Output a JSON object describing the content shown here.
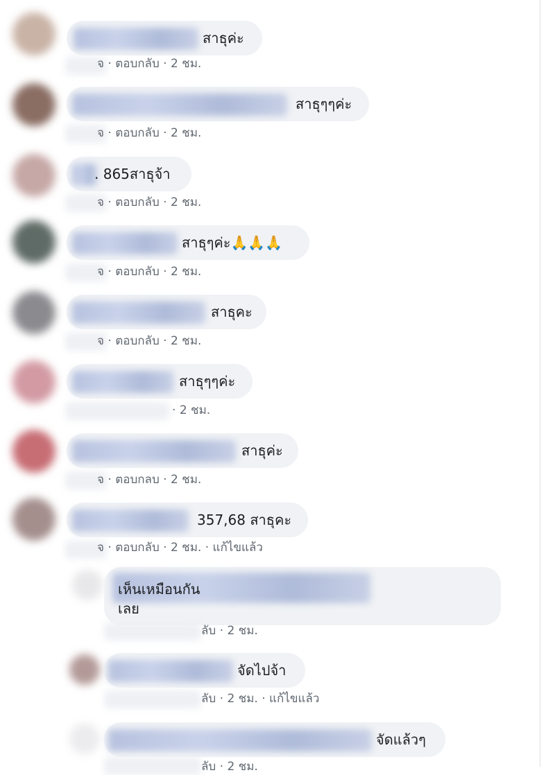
{
  "comments": [
    {
      "text": "สาธุค่ะ",
      "meta": {
        "like": "จ",
        "reply": "ตอบกลับ",
        "time": "2 ชม."
      }
    },
    {
      "text": "สาธุๆๆค่ะ",
      "meta": {
        "like": "จ",
        "reply": "ตอบกลับ",
        "time": "2 ชม."
      }
    },
    {
      "text": ". 865สาธุจ้า",
      "meta": {
        "like": "จ",
        "reply": "ตอบกลับ",
        "time": "2 ชม."
      }
    },
    {
      "text": "สาธุๆค่ะ🙏🙏🙏",
      "meta": {
        "like": "จ",
        "reply": "ตอบกลับ",
        "time": "2 ชม."
      }
    },
    {
      "text": "สาธุคะ",
      "meta": {
        "like": "จ",
        "reply": "ตอบกลับ",
        "time": "2 ชม."
      }
    },
    {
      "text": "สาธุๆๆค่ะ",
      "meta": {
        "like": "",
        "reply": "",
        "time": "2 ชม."
      }
    },
    {
      "text": "สาธุค่ะ",
      "meta": {
        "like": "จ",
        "reply": "ตอบกลบ",
        "time": "2 ชม."
      }
    },
    {
      "text": "357,68 สาธุคะ",
      "meta": {
        "like": "จ",
        "reply": "ตอบกลับ",
        "time": "2 ชม.",
        "edited": "แก้ไขแล้ว"
      }
    }
  ],
  "replies": [
    {
      "text": "เห็นเหมือนกัน\nเลย",
      "meta": {
        "reply": "ลับ",
        "time": "2 ชม."
      }
    },
    {
      "text": "จัดไปจ้า",
      "meta": {
        "reply": "ลับ",
        "time": "2 ชม.",
        "edited": "แก้ไขแล้ว"
      }
    },
    {
      "text": "จัดแล้วๆ",
      "meta": {
        "reply": "ลับ",
        "time": "2 ชม."
      }
    }
  ],
  "sep": " · ",
  "colors": {
    "bubble": "#f0f2f5",
    "meta": "#606770",
    "name_blur": "#b7c2df"
  }
}
